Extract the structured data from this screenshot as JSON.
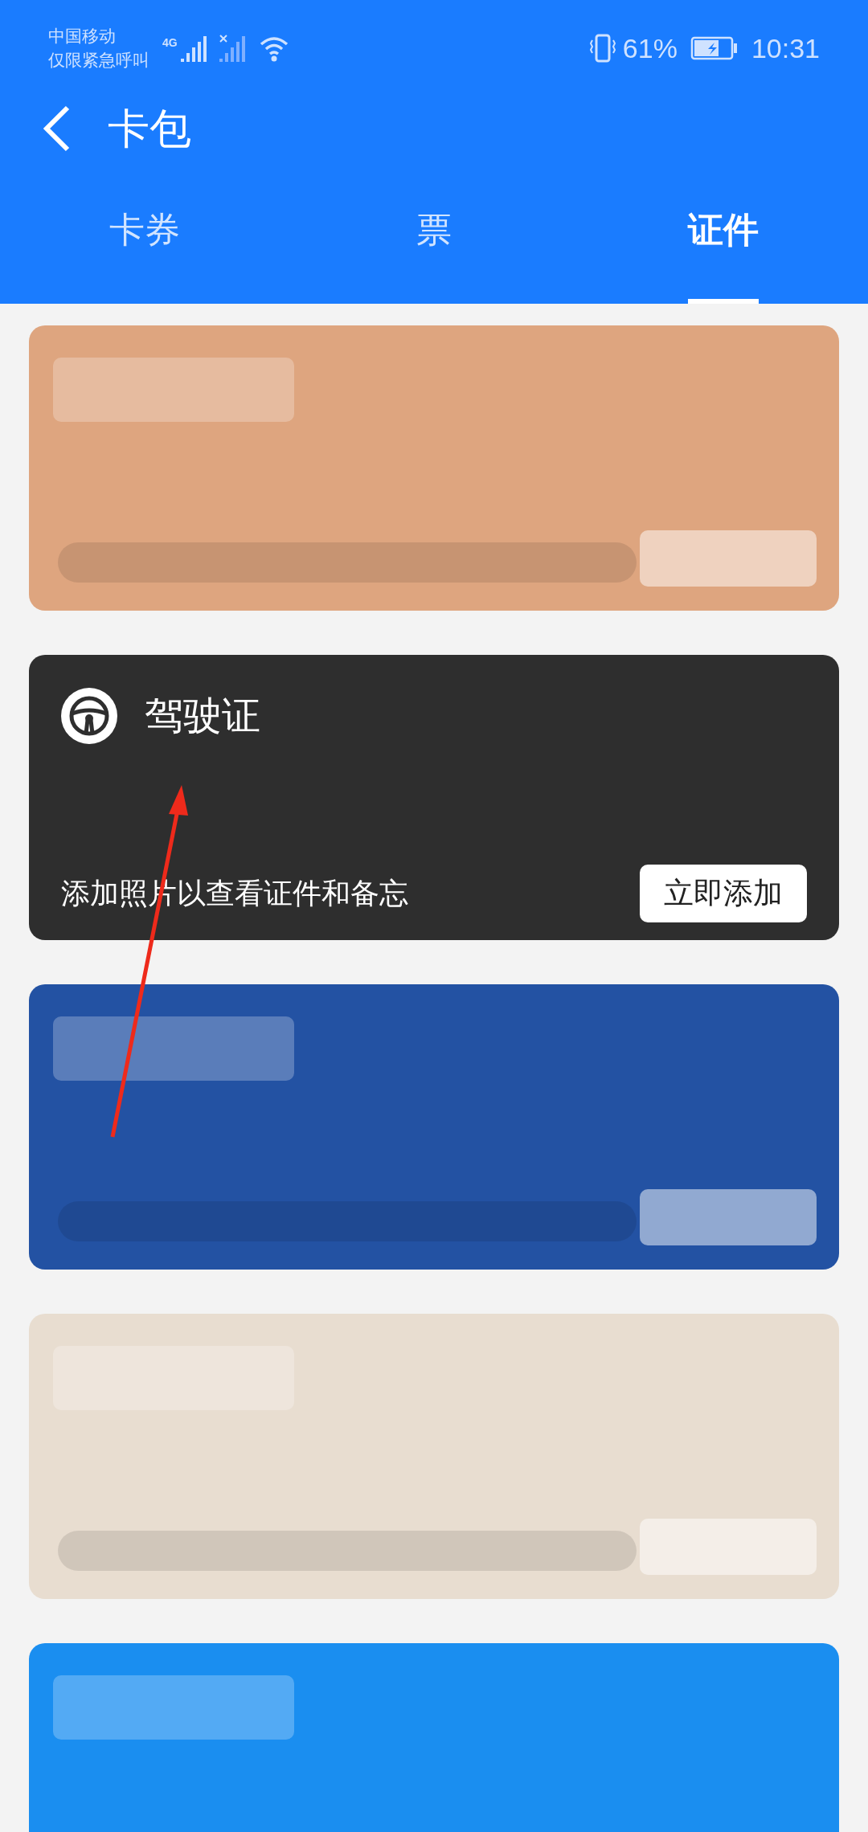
{
  "status_bar": {
    "carrier": "中国移动",
    "carrier_status": "仅限紧急呼叫",
    "network_type": "4G",
    "battery": "61%",
    "time": "10:31"
  },
  "header": {
    "title": "卡包"
  },
  "tabs": [
    {
      "label": "卡券",
      "selected": false
    },
    {
      "label": "票",
      "selected": false
    },
    {
      "label": "证件",
      "selected": true
    }
  ],
  "cards": [
    {
      "kind": "blurred",
      "color": "#dea57f"
    },
    {
      "kind": "license",
      "title": "驾驶证",
      "hint": "添加照片以查看证件和备忘",
      "button": "立即添加"
    },
    {
      "kind": "blurred",
      "color": "#2352a3"
    },
    {
      "kind": "blurred",
      "color": "#e8ddd0"
    },
    {
      "kind": "blurred",
      "color": "#1a8ef0"
    }
  ]
}
